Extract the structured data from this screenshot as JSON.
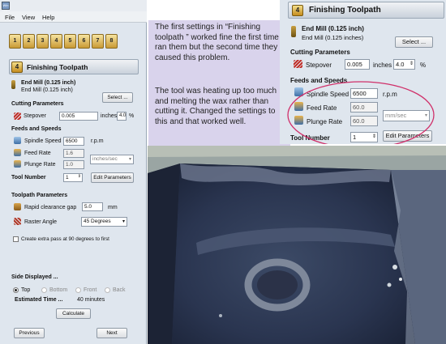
{
  "left_app": {
    "window_icon_text": "Win 3D",
    "menu": [
      "File",
      "View",
      "Help"
    ],
    "toolbar_icons": [
      "1",
      "2",
      "3",
      "4",
      "5",
      "6",
      "7",
      "8"
    ],
    "section_title": "Finishing Toolpath",
    "tool_name": "End Mill (0.125 inch)",
    "tool_desc": "End Mill (0.125 inch)",
    "select_label": "Select ...",
    "cutting_params_label": "Cutting Parameters",
    "stepover_label": "Stepover",
    "stepover_value": "0.005",
    "stepover_unit": "inches",
    "stepover_pct": "4.0",
    "pct_symbol": "%",
    "feeds_label": "Feeds and Speeds",
    "spindle_label": "Spindle Speed",
    "spindle_value": "6500",
    "spindle_unit": "r.p.m",
    "feed_label": "Feed Rate",
    "feed_value": "1.6",
    "plunge_label": "Plunge Rate",
    "plunge_value": "1.0",
    "rate_unit": "inches/sec",
    "tool_number_label": "Tool Number",
    "tool_number_value": "1",
    "edit_params_label": "Edit Parameters",
    "toolpath_params_label": "Toolpath Parameters",
    "rapid_label": "Rapid clearance gap",
    "rapid_value": "5.0",
    "rapid_unit": "mm",
    "raster_label": "Raster Angle",
    "raster_value": "45 Degrees",
    "extra_pass_label": "Create extra pass at 90 degrees to first",
    "side_label": "Side Displayed ...",
    "sides": [
      "Top",
      "Bottom",
      "Front",
      "Back"
    ],
    "est_time_label": "Estimated Time ...",
    "est_time_value": "40 minutes",
    "calculate_label": "Calculate",
    "previous_label": "Previous",
    "next_label": "Next"
  },
  "note": {
    "para1": "The first settings in “Finishing toolpath ” worked fine the first time I ran them but the second time they caused this problem.",
    "para2": "The tool was heating up too much and melting the wax rather than cutting it. Changed the settings to this and that worked well."
  },
  "right_panel": {
    "section_title": "Finishing Toolpath",
    "tool_name": "End Mill (0.125 inch)",
    "tool_desc": "End Mill (0.125 inches)",
    "select_label": "Select ...",
    "cutting_params_label": "Cutting Parameters",
    "stepover_label": "Stepover",
    "stepover_value": "0.005",
    "stepover_unit": "inches",
    "stepover_pct": "4.0",
    "pct_symbol": "%",
    "feeds_label": "Feeds and Speeds",
    "spindle_label": "Spindle Speed",
    "spindle_value": "6500",
    "spindle_unit": "r.p.m",
    "feed_label": "Feed Rate",
    "feed_value": "60.0",
    "plunge_label": "Plunge Rate",
    "plunge_value": "60.0",
    "rate_unit": "mm/sec",
    "tool_number_label": "Tool Number",
    "tool_number_value": "1",
    "edit_params_label": "Edit Parameters"
  },
  "colors": {
    "panel_bg": "#dfe6ee",
    "note_bg": "#d9d3ec",
    "highlight_ellipse": "#d0306a"
  }
}
